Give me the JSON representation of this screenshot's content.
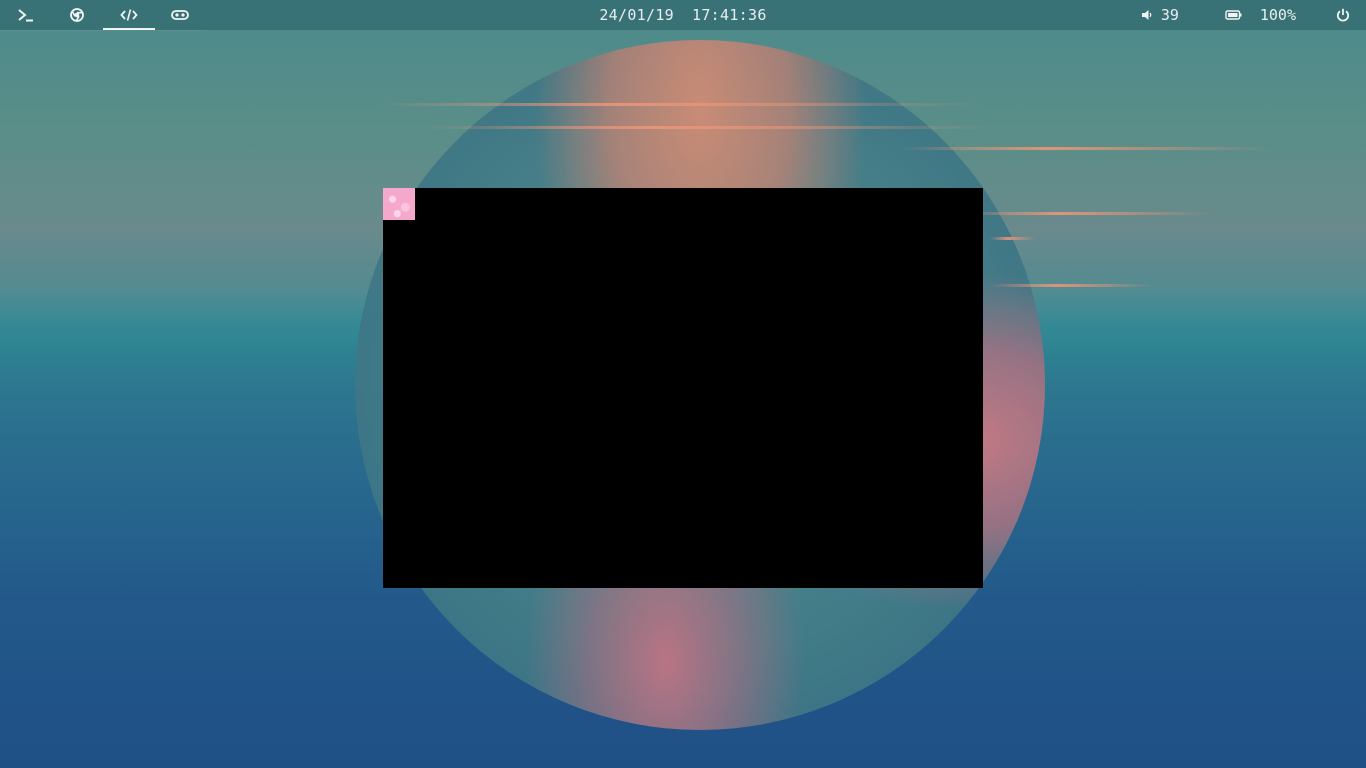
{
  "topbar": {
    "workspaces": [
      {
        "icon": "terminal-icon",
        "active": false
      },
      {
        "icon": "chrome-icon",
        "active": false
      },
      {
        "icon": "code-icon",
        "active": true
      },
      {
        "icon": "gamepad-icon",
        "active": false
      }
    ],
    "date": "24/01/19",
    "time": "17:41:36",
    "volume": {
      "icon": "speaker-icon",
      "value": "39"
    },
    "battery": {
      "icon": "battery-icon",
      "value": "100%"
    },
    "power": {
      "icon": "power-icon"
    }
  },
  "window": {
    "background": "#000000",
    "icon_color": "#f4a9cc"
  },
  "colors": {
    "bar_text": "#e8eef0",
    "active_indicator": "#f1f4f4"
  }
}
